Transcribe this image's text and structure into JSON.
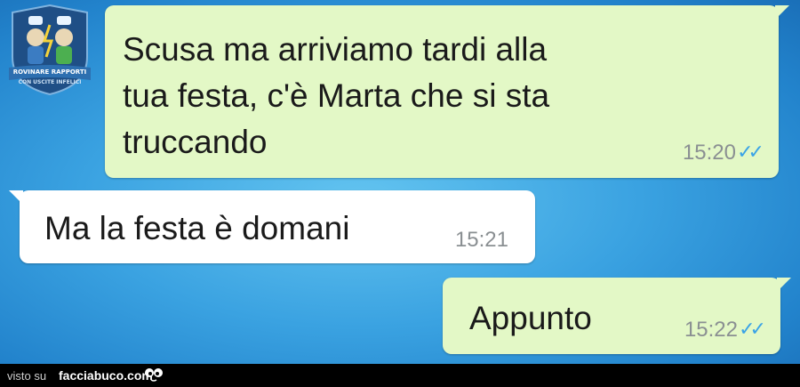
{
  "messages": [
    {
      "direction": "outgoing",
      "text": "Scusa ma arriviamo tardi alla\ntua festa, c'è Marta che si sta\ntruccando",
      "time": "15:20",
      "status_icon": "double-check-read-icon"
    },
    {
      "direction": "incoming",
      "text": "Ma la festa è domani",
      "time": "15:21"
    },
    {
      "direction": "outgoing",
      "text": "Appunto",
      "time": "15:22",
      "status_icon": "double-check-read-icon"
    }
  ],
  "watermark": {
    "line1": "ROVINARE RAPPORTI",
    "line2": "CON USCITE INFELICI"
  },
  "footer": {
    "visto_su": "visto su",
    "site": "facciabuco.com"
  },
  "colors": {
    "outgoing_bubble": "#e3f8c6",
    "incoming_bubble": "#ffffff",
    "background": "#3aa2e1",
    "read_ticks": "#3aa3e6",
    "timestamp": "#8a8f92"
  }
}
